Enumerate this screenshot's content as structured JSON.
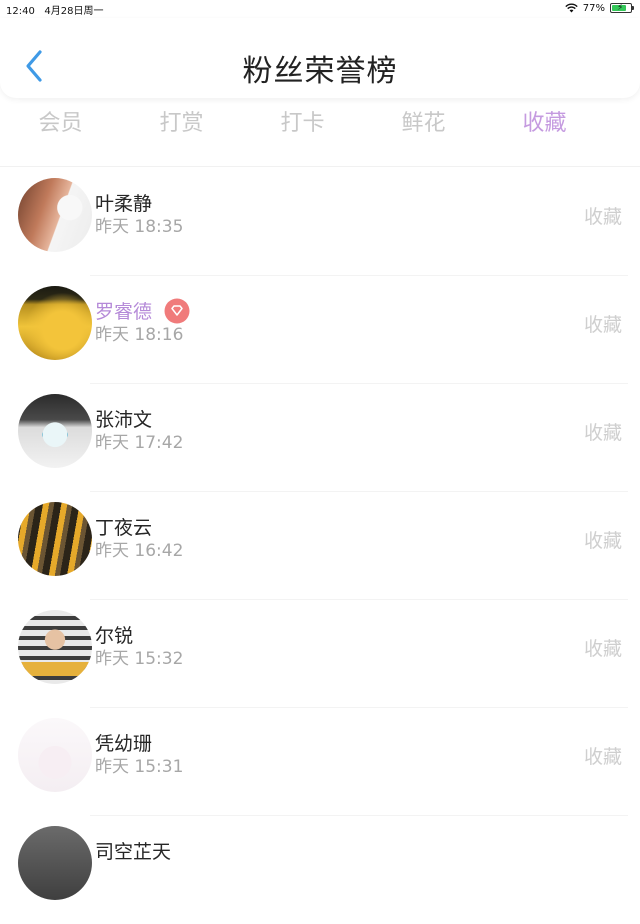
{
  "status_bar": {
    "time": "12:40",
    "date": "4月28日周一",
    "battery": "77%",
    "battery_level": 0.77,
    "wifi_icon": "wifi-icon",
    "battery_icon": "battery-charging-icon"
  },
  "header": {
    "title": "粉丝荣誉榜",
    "back_icon": "chevron-left-icon",
    "back_color": "#3f9ae6"
  },
  "tabs": [
    {
      "label": "会员",
      "active": false
    },
    {
      "label": "打赏",
      "active": false
    },
    {
      "label": "打卡",
      "active": false
    },
    {
      "label": "鲜花",
      "active": false
    },
    {
      "label": "收藏",
      "active": true
    }
  ],
  "colors": {
    "active_tab": "#c59be0",
    "highlight_name": "#b58ad8",
    "badge": "#f07b7b"
  },
  "fans": [
    {
      "name": "叶柔静",
      "time": "昨天 18:35",
      "action": "收藏"
    },
    {
      "name": "罗睿德",
      "time": "昨天 18:16",
      "action": "收藏",
      "highlight": true,
      "badge_icon": "diamond-badge-icon"
    },
    {
      "name": "张沛文",
      "time": "昨天 17:42",
      "action": "收藏"
    },
    {
      "name": "丁夜云",
      "time": "昨天 16:42",
      "action": "收藏"
    },
    {
      "name": "尔锐",
      "time": "昨天 15:32",
      "action": "收藏"
    },
    {
      "name": "凭幼珊",
      "time": "昨天 15:31",
      "action": "收藏"
    },
    {
      "name": "司空芷天",
      "time": "",
      "action": ""
    }
  ]
}
